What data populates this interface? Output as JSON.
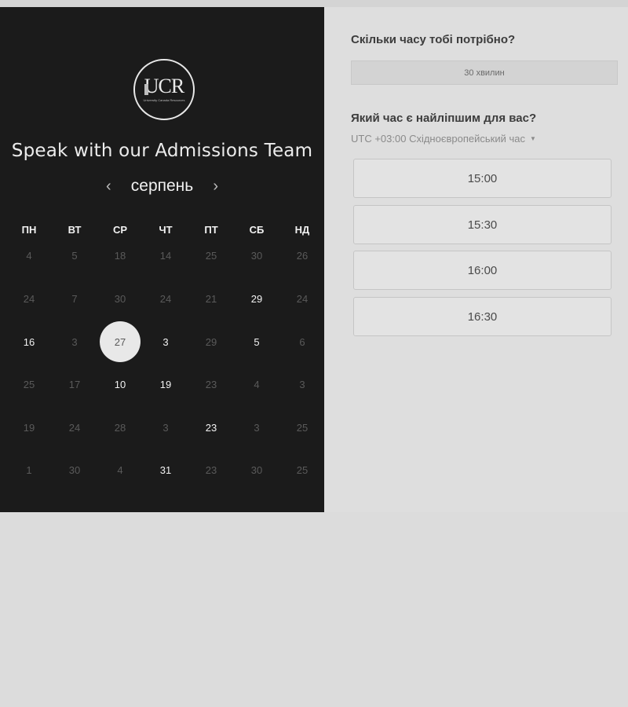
{
  "logo": {
    "text": "UCR",
    "subtitle": "University Canada Resources"
  },
  "calendar": {
    "heading": "Speak with our Admissions Team",
    "month": "серпень",
    "prev_icon": "chevron-left-icon",
    "next_icon": "chevron-right-icon",
    "weekdays": [
      "ПН",
      "ВТ",
      "СР",
      "ЧТ",
      "ПТ",
      "СБ",
      "НД"
    ],
    "days": [
      [
        "4",
        "5",
        "18",
        "14",
        "25",
        "30",
        "26"
      ],
      [
        "24",
        "7",
        "30",
        "24",
        "21",
        "29",
        "24"
      ],
      [
        "16",
        "3",
        "27",
        "3",
        "29",
        "5",
        "6"
      ],
      [
        "25",
        "17",
        "10",
        "19",
        "23",
        "4",
        "3"
      ],
      [
        "19",
        "24",
        "28",
        "3",
        "23",
        "3",
        "25"
      ],
      [
        "1",
        "30",
        "4",
        "31",
        "23",
        "30",
        "25"
      ]
    ],
    "available": [
      [
        1,
        5
      ],
      [
        2,
        0
      ],
      [
        2,
        3
      ],
      [
        2,
        5
      ],
      [
        3,
        2
      ],
      [
        3,
        3
      ],
      [
        4,
        4
      ],
      [
        5,
        3
      ]
    ],
    "selected": [
      2,
      2
    ]
  },
  "booking": {
    "duration_question": "Скільки часу тобі потрібно?",
    "duration_value": "30 хвилин",
    "time_question": "Який час є найліпшим для вас?",
    "timezone": "UTC +03:00 Східноєвропейський час",
    "timeslots": [
      "15:00",
      "15:30",
      "16:00",
      "16:30"
    ]
  }
}
